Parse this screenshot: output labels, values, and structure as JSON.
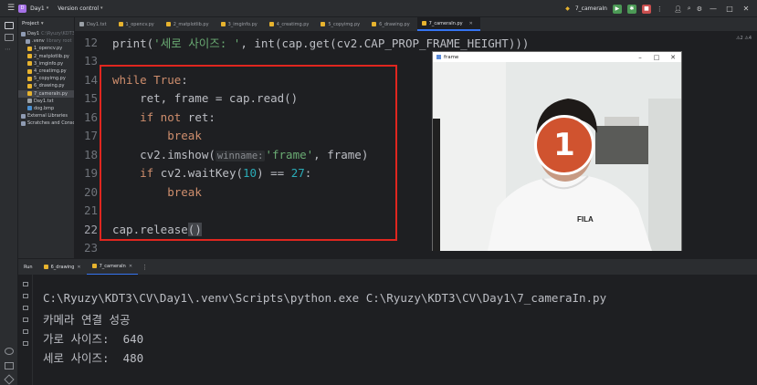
{
  "titlebar": {
    "project_badge": "D",
    "project_name": "Day1",
    "vcs_label": "Version control",
    "run_config": "7_cameraIn",
    "window_controls": [
      "—",
      "□",
      "✕"
    ]
  },
  "project_panel": {
    "title": "Project",
    "items": [
      {
        "label": "Day1",
        "sub": "C:\\Ryuzy\\KDT3\\CV\\Day1",
        "type": "folder"
      },
      {
        "label": ".venv",
        "sub": "library root",
        "type": "folder"
      },
      {
        "label": "1_opencv.py",
        "type": "py"
      },
      {
        "label": "2_matplotlib.py",
        "type": "py"
      },
      {
        "label": "3_imginfo.py",
        "type": "py"
      },
      {
        "label": "4_creatimg.py",
        "type": "py"
      },
      {
        "label": "5_copyimg.py",
        "type": "py"
      },
      {
        "label": "6_drawing.py",
        "type": "py"
      },
      {
        "label": "7_cameraIn.py",
        "type": "py"
      },
      {
        "label": "Day1.txt",
        "type": "txt"
      },
      {
        "label": "dog.bmp",
        "type": "img"
      },
      {
        "label": "External Libraries",
        "type": "lib"
      },
      {
        "label": "Scratches and Consoles",
        "type": "scratch"
      }
    ]
  },
  "tabs": [
    {
      "label": "Day1.txt",
      "type": "txt",
      "active": false
    },
    {
      "label": "1_opencv.py",
      "type": "py",
      "active": false
    },
    {
      "label": "2_matplotlib.py",
      "type": "py",
      "active": false
    },
    {
      "label": "3_imginfo.py",
      "type": "py",
      "active": false
    },
    {
      "label": "4_creatimg.py",
      "type": "py",
      "active": false
    },
    {
      "label": "5_copyimg.py",
      "type": "py",
      "active": false
    },
    {
      "label": "6_drawing.py",
      "type": "py",
      "active": false
    },
    {
      "label": "7_cameraIn.py",
      "type": "py",
      "active": true
    }
  ],
  "editor": {
    "inspection": "⚠2 ⚠4",
    "line_numbers": [
      "12",
      "13",
      "14",
      "15",
      "16",
      "17",
      "18",
      "19",
      "20",
      "21",
      "22",
      "23"
    ],
    "parameter_hint": "winname:"
  },
  "frame_window": {
    "title": "frame",
    "badge": "1",
    "shirt_logo": "FILA"
  },
  "run_panel": {
    "label": "Run",
    "tabs": [
      {
        "label": "6_drawing",
        "active": false
      },
      {
        "label": "7_cameraIn",
        "active": true
      }
    ],
    "output": [
      "C:\\Ryuzy\\KDT3\\CV\\Day1\\.venv\\Scripts\\python.exe C:\\Ryuzy\\KDT3\\CV\\Day1\\7_cameraIn.py",
      "카메라 연결 성공",
      "가로 사이즈:  640",
      "세로 사이즈:  480"
    ]
  }
}
